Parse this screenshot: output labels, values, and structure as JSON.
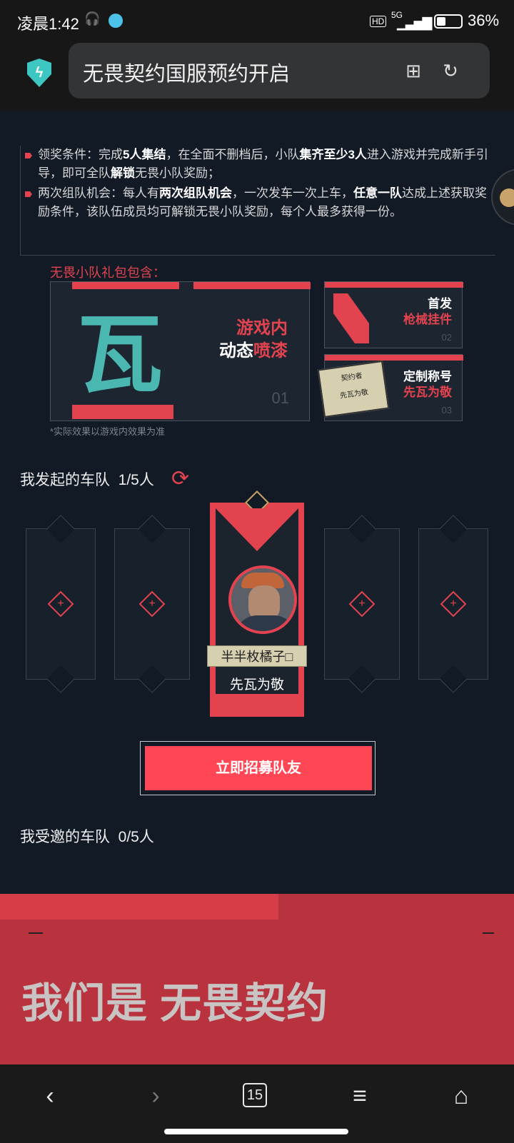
{
  "status_bar": {
    "time": "凌晨1:42",
    "network": "5G",
    "hd": "HD",
    "battery_percent": "36%",
    "battery_level": 0.36
  },
  "browser": {
    "shield_icon": "shield-bolt-icon",
    "url_title": "无畏契约国服预约开启",
    "bookmark_icon": "bookmark-add-icon",
    "reload_icon": "reload-icon"
  },
  "rules": {
    "rule1": {
      "prefix": "领奖条件：完成",
      "b1": "5人集结",
      "mid1": "，在全面不删档后，小队",
      "b2": "集齐至少3人",
      "mid2": "进入游戏并完成新手引导，即可全队",
      "b3": "解锁",
      "suffix": "无畏小队奖励；"
    },
    "rule2": {
      "prefix": "两次组队机会：每人有",
      "b1": "两次组队机会",
      "mid1": "，一次发车一次上车，",
      "b2": "任意一队",
      "suffix": "达成上述获取奖励条件，该队伍成员均可解锁无畏小队奖励，每个人最多获得一份。"
    }
  },
  "gifts": {
    "title": "无畏小队礼包包含：",
    "item1": {
      "line1": "游戏内",
      "line2a": "动态",
      "line2b": "喷漆",
      "num": "01",
      "glyph": "瓦"
    },
    "item2": {
      "line1": "首发",
      "line2": "枪械挂件",
      "num": "02"
    },
    "item3": {
      "line1": "定制称号",
      "line2": "先瓦为敬",
      "num": "03",
      "card_top": "契约者",
      "card_bottom": "先瓦为敬"
    },
    "note": "*实际效果以游戏内效果为准"
  },
  "my_team": {
    "label": "我发起的车队",
    "count": "1/5人",
    "leader_name": "半半枚橘子□",
    "leader_title": "先瓦为敬",
    "plus_symbol": "+"
  },
  "recruit_button": "立即招募队友",
  "invited_team": {
    "label": "我受邀的车队",
    "count": "0/5人"
  },
  "banner": {
    "text": "我们是 无畏契约"
  },
  "nav": {
    "back": "‹",
    "forward": "›",
    "tabs": "15",
    "menu": "≡",
    "home": "⌂"
  },
  "colors": {
    "accent": "#ff4655",
    "teal": "#4ab7b0",
    "background": "#121a26"
  }
}
